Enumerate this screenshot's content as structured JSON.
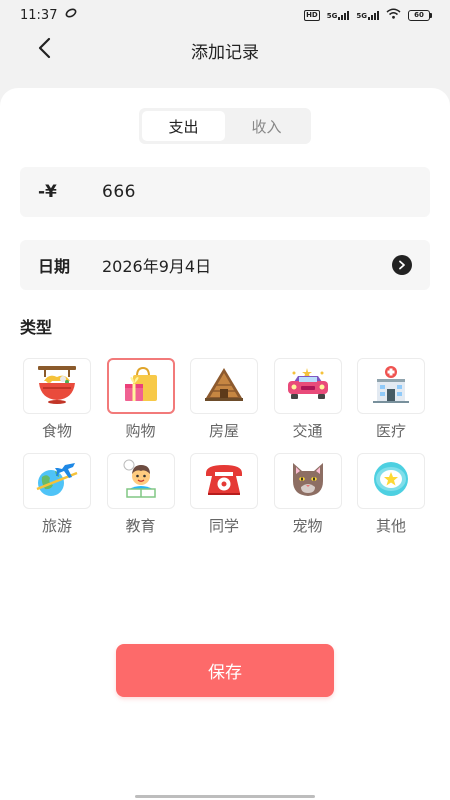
{
  "status_bar": {
    "time": "11:37",
    "hd_badge": "HD",
    "signal_label_1": "5G",
    "signal_label_2": "5G",
    "battery_text": "60"
  },
  "header": {
    "title": "添加记录",
    "back_icon": "chevron-left-icon"
  },
  "type_tabs": [
    {
      "label": "支出",
      "active": true
    },
    {
      "label": "收入",
      "active": false
    }
  ],
  "amount": {
    "prefix": "-¥",
    "value": "666"
  },
  "date": {
    "label": "日期",
    "value": "2026年9月4日",
    "arrow_icon": "chevron-right-circle-icon"
  },
  "category_section": {
    "title": "类型",
    "items": [
      {
        "label": "食物",
        "icon": "food-bowl-icon",
        "selected": false
      },
      {
        "label": "购物",
        "icon": "shopping-bag-icon",
        "selected": true
      },
      {
        "label": "房屋",
        "icon": "house-icon",
        "selected": false
      },
      {
        "label": "交通",
        "icon": "car-icon",
        "selected": false
      },
      {
        "label": "医疗",
        "icon": "hospital-icon",
        "selected": false
      },
      {
        "label": "旅游",
        "icon": "travel-airplane-icon",
        "selected": false
      },
      {
        "label": "教育",
        "icon": "student-icon",
        "selected": false
      },
      {
        "label": "同学",
        "icon": "telephone-icon",
        "selected": false
      },
      {
        "label": "宠物",
        "icon": "cat-icon",
        "selected": false
      },
      {
        "label": "其他",
        "icon": "star-badge-icon",
        "selected": false
      }
    ]
  },
  "save_button": {
    "label": "保存"
  },
  "colors": {
    "accent": "#fd6a6a",
    "selected_border": "#f27a7a",
    "field_bg": "#f6f6f6",
    "page_bg": "#f2f2f2"
  }
}
